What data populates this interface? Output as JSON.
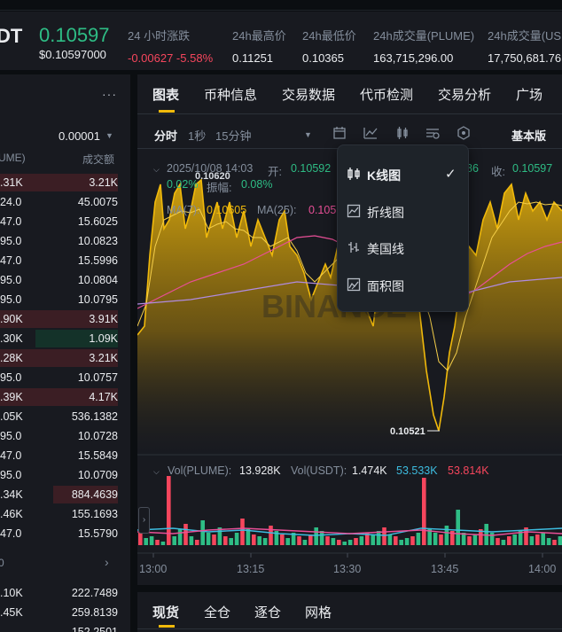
{
  "ticker": {
    "symbol": "DT",
    "last_price": "0.10597",
    "usd_price": "$0.10597000",
    "stats": [
      {
        "label": "24 小时涨跌",
        "value": "-0.00627 -5.58%"
      },
      {
        "label": "24h最高价",
        "value": "0.11251"
      },
      {
        "label": "24h最低价",
        "value": "0.10365"
      },
      {
        "label": "24h成交量(PLUME)",
        "value": "163,715,296.00"
      },
      {
        "label": "24h成交量(US",
        "value": "17,750,681.76"
      }
    ]
  },
  "orderbook": {
    "more_label": "···",
    "precision": "0.00001",
    "head_left": "UME)",
    "head_right": "成交额",
    "rows": [
      {
        "price": ".31K",
        "amount": "3.21K",
        "side": "ask",
        "depth": 1.0
      },
      {
        "price": "24.0",
        "amount": "45.0075",
        "side": "none",
        "depth": 0
      },
      {
        "price": "47.0",
        "amount": "15.6025",
        "side": "none",
        "depth": 0
      },
      {
        "price": "95.0",
        "amount": "10.0823",
        "side": "none",
        "depth": 0
      },
      {
        "price": "47.0",
        "amount": "15.5996",
        "side": "none",
        "depth": 0
      },
      {
        "price": "95.0",
        "amount": "10.0804",
        "side": "none",
        "depth": 0
      },
      {
        "price": "95.0",
        "amount": "10.0795",
        "side": "none",
        "depth": 0
      },
      {
        "price": ".90K",
        "amount": "3.91K",
        "side": "ask",
        "depth": 1.0
      },
      {
        "price": ".30K",
        "amount": "1.09K",
        "side": "bid",
        "depth": 0.7
      },
      {
        "price": ".28K",
        "amount": "3.21K",
        "side": "ask",
        "depth": 1.0
      },
      {
        "price": "95.0",
        "amount": "10.0757",
        "side": "none",
        "depth": 0
      },
      {
        "price": ".39K",
        "amount": "4.17K",
        "side": "ask",
        "depth": 1.0
      },
      {
        "price": ".05K",
        "amount": "536.1382",
        "side": "none",
        "depth": 0
      },
      {
        "price": "95.0",
        "amount": "10.0728",
        "side": "none",
        "depth": 0
      },
      {
        "price": "47.0",
        "amount": "15.5849",
        "side": "none",
        "depth": 0
      },
      {
        "price": "95.0",
        "amount": "10.0709",
        "side": "none",
        "depth": 0
      },
      {
        "price": ".34K",
        "amount": "884.4639",
        "side": "ask",
        "depth": 0.55
      },
      {
        "price": ".46K",
        "amount": "155.1693",
        "side": "none",
        "depth": 0
      },
      {
        "price": "47.0",
        "amount": "15.5790",
        "side": "none",
        "depth": 0
      }
    ],
    "sep_left": "0",
    "sep_right": "›",
    "lower_rows": [
      {
        "price": ".10K",
        "amount": "222.7489"
      },
      {
        "price": ".45K",
        "amount": "259.8139"
      },
      {
        "price": "",
        "amount": "152.2501"
      }
    ]
  },
  "tabs": [
    "图表",
    "币种信息",
    "交易数据",
    "代币检测",
    "交易分析",
    "广场"
  ],
  "toolbar": {
    "time_line": "分时",
    "one_sec": "1秒",
    "fifteen_min": "15分钟",
    "basic": "基本版"
  },
  "ohlc": {
    "date": "2025/10/08 14:03",
    "open_label": "开:",
    "open": "0.10592",
    "close_label": "收:",
    "close": "0.10597",
    "low_part": "86",
    "change": "0.02%",
    "amp_label": "振幅:",
    "amp": "0.08%",
    "overlap_price": "0.10620"
  },
  "ma": {
    "ma1_label": "MA(7):",
    "ma1": "0.10605",
    "ma2_label": "MA(25):",
    "ma2": "0.105"
  },
  "watermark": "BINANCE",
  "low_marker": "0.10521",
  "volume": {
    "label_plume": "Vol(PLUME):",
    "plume": "13.928K",
    "label_usdt": "Vol(USDT):",
    "usdt": "1.474K",
    "v1": "53.533K",
    "v2": "53.814K"
  },
  "time_axis": [
    "13:00",
    "13:15",
    "13:30",
    "13:45",
    "14:00"
  ],
  "dropdown": [
    {
      "label": "K线图",
      "icon": "candlestick-icon",
      "selected": true
    },
    {
      "label": "折线图",
      "icon": "line-chart-icon",
      "selected": false
    },
    {
      "label": "美国线",
      "icon": "ohlc-bar-icon",
      "selected": false
    },
    {
      "label": "面积图",
      "icon": "area-chart-icon",
      "selected": false
    }
  ],
  "bottom_tabs": [
    "现货",
    "全仓",
    "逐仓",
    "网格"
  ],
  "colors": {
    "up": "#2ebd85",
    "down": "#f6465d",
    "accent": "#f0b90b",
    "ma25": "#e84f97",
    "ma99": "#b08be0"
  },
  "chart_data": {
    "type": "area",
    "x": [
      "13:00",
      "13:15",
      "13:30",
      "13:45",
      "14:00"
    ],
    "price_low": 0.10521,
    "series": [
      {
        "name": "MA(7)",
        "values": [
          0.10605
        ]
      },
      {
        "name": "MA(25)",
        "values": [
          0.105
        ]
      }
    ],
    "volume": {
      "plume": "13.928K",
      "usdt": "1.474K"
    }
  }
}
